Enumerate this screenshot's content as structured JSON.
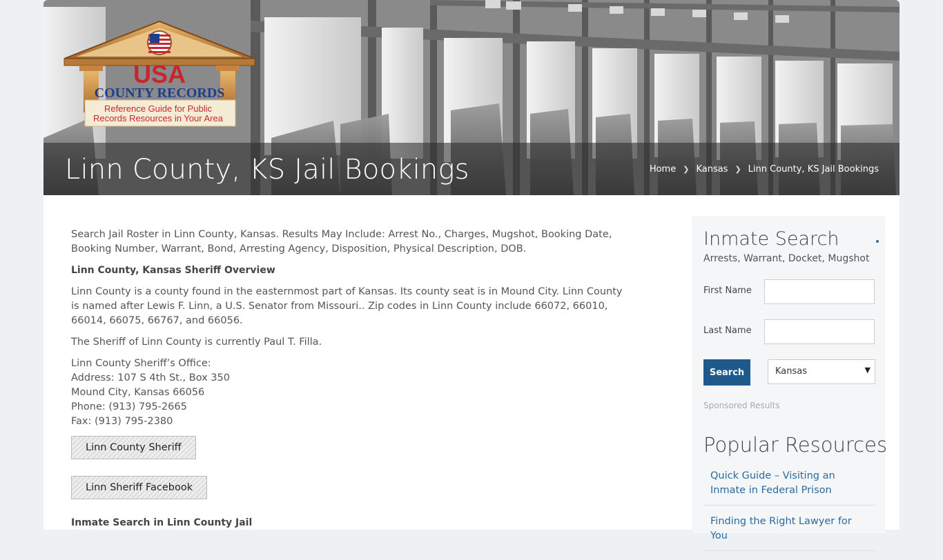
{
  "hero": {
    "title": "Linn County, KS Jail Bookings",
    "breadcrumb": [
      {
        "label": "Home"
      },
      {
        "label": "Kansas"
      },
      {
        "label": "Linn County, KS Jail Bookings"
      }
    ],
    "logo": {
      "line1": "USA",
      "line2": "COUNTY RECORDS",
      "tagline1": "Reference Guide for Public",
      "tagline2": "Records Resources in Your Area"
    }
  },
  "main": {
    "intro": "Search Jail Roster in Linn County, Kansas. Results May Include: Arrest No., Charges, Mugshot, Booking Date, Booking Number, Warrant, Bond, Arresting Agency, Disposition, Physical Description, DOB.",
    "overview_heading": "Linn County, Kansas Sheriff Overview",
    "overview_text": "Linn County is a county found in the easternmost part of Kansas. Its county seat is in Mound City. Linn County is named after Lewis F. Linn, a U.S. Senator from Missouri.. Zip codes in Linn County include 66072, 66010, 66014, 66075, 66767, and 66056.",
    "sheriff_text": "The Sheriff of Linn County is currently Paul T. Filla.",
    "office": {
      "name": "Linn County Sheriff’s Office:",
      "address": "Address: 107 S 4th St., Box 350",
      "city": "Mound City, Kansas 66056",
      "phone": "Phone: (913) 795-2665",
      "fax": "Fax: (913) 795-2380"
    },
    "buttons": {
      "sheriff": "Linn County Sheriff",
      "facebook": "Linn Sheriff Facebook"
    },
    "inmate_heading": "Inmate Search in Linn County Jail"
  },
  "sidebar": {
    "title": "Inmate Search",
    "subtitle": "Arrests, Warrant, Docket, Mugshot",
    "first_name_label": "First Name",
    "last_name_label": "Last Name",
    "first_name_value": "",
    "last_name_value": "",
    "search_label": "Search",
    "state_selected": "Kansas",
    "sponsored": "Sponsored Results",
    "resources_title": "Popular Resources",
    "resources": [
      {
        "label": "Quick Guide – Visiting an Inmate in Federal Prison"
      },
      {
        "label": "Finding the Right Lawyer for You"
      }
    ]
  },
  "colors": {
    "accent": "#1d5a8b",
    "link": "#2a6aa0",
    "page_bg": "#edf1f4"
  }
}
